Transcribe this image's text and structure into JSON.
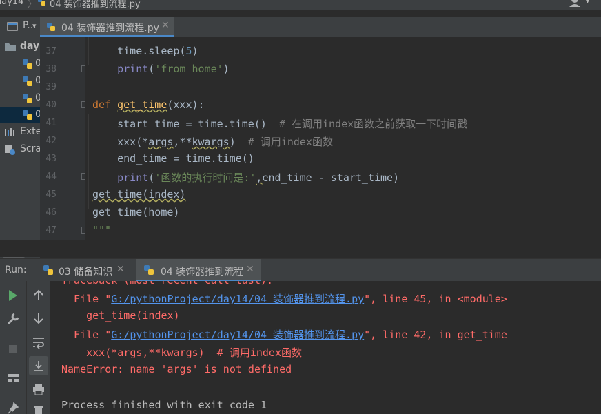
{
  "breadcrumb": {
    "folder": "day14",
    "file": "04 装饰器推到流程.py"
  },
  "tabs": {
    "project_label": "P...",
    "active_file": "04 装饰器推到流程.py"
  },
  "project_tree": {
    "root": "day1",
    "items": [
      "0",
      "0",
      "0",
      "0"
    ],
    "external": "Exte",
    "scratches": "Scra"
  },
  "editor": {
    "lines": [
      {
        "n": "37",
        "kind": "sleep",
        "text": {
          "a": "    time.sleep(",
          "b": "5",
          "c": ")"
        }
      },
      {
        "n": "38",
        "kind": "print_home",
        "text": {
          "a": "print",
          "b": "(",
          "c": "'from home'",
          "d": ")"
        }
      },
      {
        "n": "39",
        "kind": "empty"
      },
      {
        "n": "40",
        "kind": "def",
        "text": {
          "a": "def ",
          "b": "get_time",
          "c": "(xxx):"
        }
      },
      {
        "n": "41",
        "kind": "start",
        "text": {
          "a": "    start_time = time.time()  ",
          "b": "# 在调用index函数之前获取一下时间戳"
        }
      },
      {
        "n": "42",
        "kind": "call",
        "text": {
          "a": "    xxx(*",
          "b": "args",
          "c": ",**",
          "d": "kwargs",
          "e": ")  ",
          "f": "# 调用index函数"
        }
      },
      {
        "n": "43",
        "kind": "end",
        "text": {
          "a": "    end_time = time.time()"
        }
      },
      {
        "n": "44",
        "kind": "print_time",
        "text": {
          "a": "    ",
          "b": "print",
          "c": "(",
          "d": "'函数的执行时间是:'",
          "e": ",",
          "f": "end_time - start_time)"
        }
      },
      {
        "n": "45",
        "kind": "call1",
        "text": {
          "a": "get_time(index)"
        }
      },
      {
        "n": "46",
        "kind": "call2",
        "text": {
          "a": "get_time(home)"
        }
      },
      {
        "n": "47",
        "kind": "doc",
        "text": {
          "a": "\"\"\""
        }
      }
    ]
  },
  "run": {
    "label": "Run:",
    "tab1": "03 储备知识",
    "tab2": "04 装饰器推到流程"
  },
  "console": {
    "line0": "Traceback (most recent call last):",
    "line1": {
      "a": "  File \"",
      "link": "G:/pythonProject/day14/04 装饰器推到流程.py",
      "b": "\", line 45, in <module>"
    },
    "line2": "    get_time(index)",
    "line3": {
      "a": "  File \"",
      "link": "G:/pythonProject/day14/04 装饰器推到流程.py",
      "b": "\", line 42, in get_time"
    },
    "line4": "    xxx(*args,**kwargs)  # 调用index函数",
    "line5": "NameError: name 'args' is not defined",
    "line6": "",
    "line7": "Process finished with exit code 1"
  },
  "colors": {
    "accent": "#4a88c7",
    "error": "#ff6b68",
    "link": "#5394ec"
  }
}
